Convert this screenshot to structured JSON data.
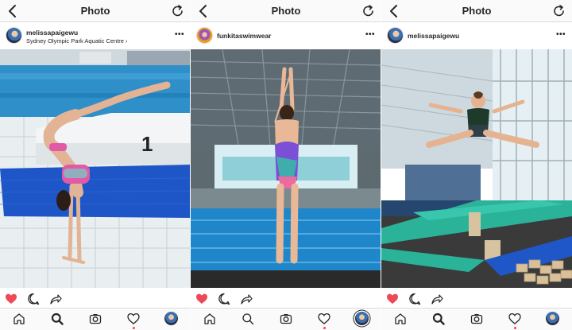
{
  "colors": {
    "like_red": "#ed4956",
    "icon_dark": "#262626",
    "bar_bg": "#fafafa",
    "border": "#dbdbdb"
  },
  "screens": [
    {
      "nav_title": "Photo",
      "username": "melissapaigewu",
      "location": "Sydney Olympic Park Aquatic Centre ›",
      "more": "•••",
      "photo_number": "1",
      "liked": true,
      "active_tab": "search",
      "activity_dot": true
    },
    {
      "nav_title": "Photo",
      "username": "funkitaswimwear",
      "location": "",
      "more": "•••",
      "liked": true,
      "active_tab": "profile",
      "activity_dot": true
    },
    {
      "nav_title": "Photo",
      "username": "melissapaigewu",
      "location": "",
      "more": "•••",
      "liked": true,
      "active_tab": "search",
      "activity_dot": true
    }
  ],
  "icons": {
    "back": "chevron-left-icon",
    "refresh": "refresh-icon",
    "like": "heart-icon",
    "comment": "comment-icon",
    "share": "share-icon",
    "home": "home-icon",
    "search": "search-icon",
    "camera": "camera-icon",
    "activity": "heart-outline-icon",
    "profile": "profile-avatar-icon"
  }
}
